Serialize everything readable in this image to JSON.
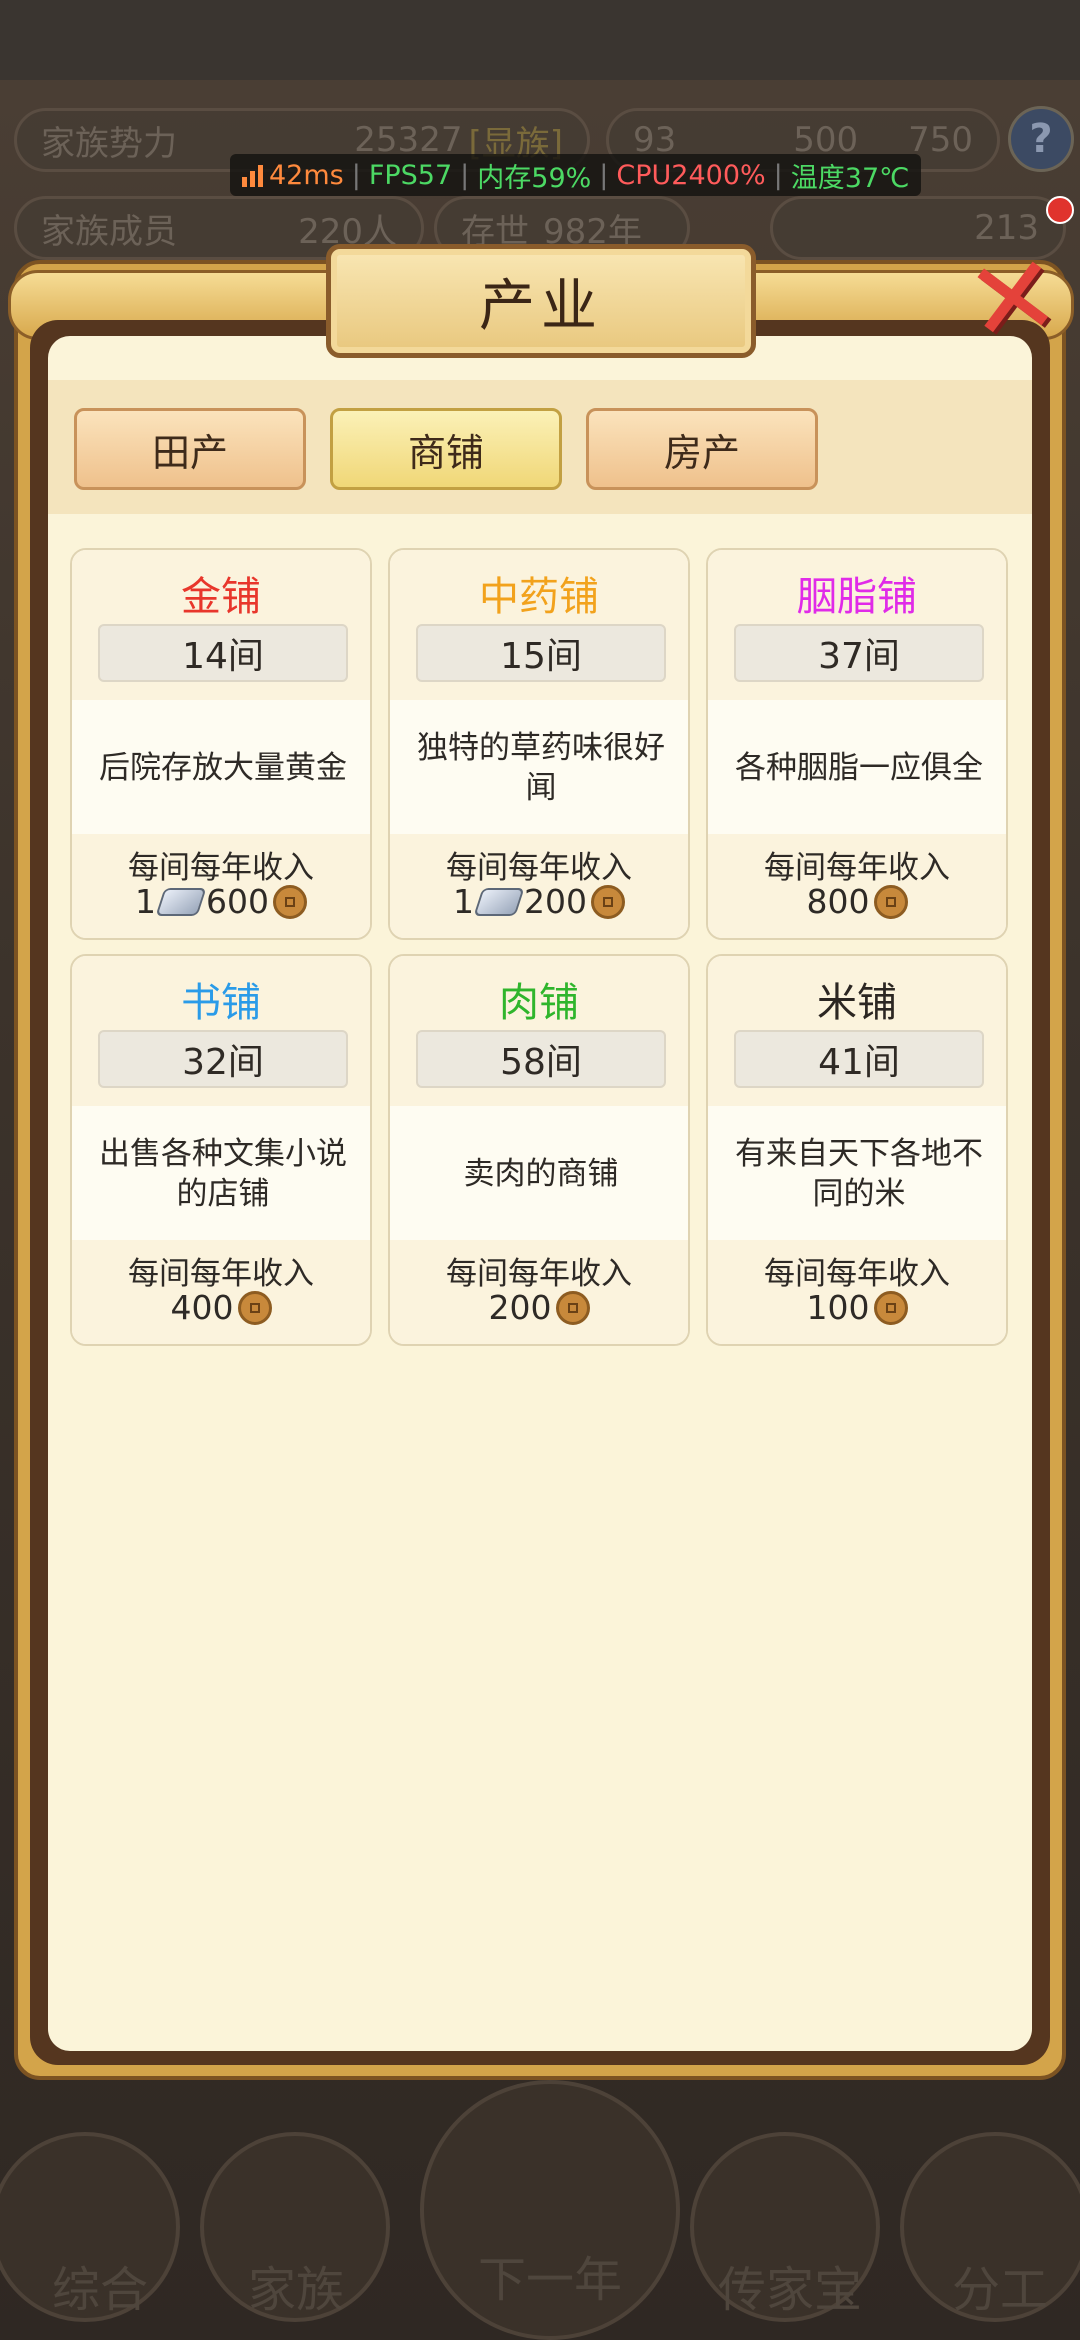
{
  "hud": {
    "power_label": "家族势力",
    "power_value": "25327",
    "power_rank": "[显族]",
    "members_label": "家族成员",
    "members_value": "220人",
    "lifespan_label": "存世",
    "lifespan_value": "982年",
    "res_gold": "93",
    "res_silver": "500",
    "res_coins": "750",
    "ingot_count": "213",
    "help": "?"
  },
  "perf": {
    "ping": "42ms",
    "fps": "FPS57",
    "memory": "内存59%",
    "cpu": "CPU2400%",
    "temp": "温度37℃"
  },
  "modal": {
    "title": "产业",
    "close_icon": "close-x-icon",
    "tabs": [
      {
        "label": "田产",
        "active": false
      },
      {
        "label": "商铺",
        "active": true
      },
      {
        "label": "房产",
        "active": false
      }
    ]
  },
  "shops": [
    {
      "name": "金铺",
      "color": "#e8362b",
      "count": "14间",
      "desc": "后院存放大量黄金",
      "income_label": "每间每年收入",
      "income_silver": "1",
      "income_coins": "600"
    },
    {
      "name": "中药铺",
      "color": "#f2a21c",
      "count": "15间",
      "desc": "独特的草药味很好闻",
      "income_label": "每间每年收入",
      "income_silver": "1",
      "income_coins": "200"
    },
    {
      "name": "胭脂铺",
      "color": "#e02be8",
      "count": "37间",
      "desc": "各种胭脂一应俱全",
      "income_label": "每间每年收入",
      "income_silver": "",
      "income_coins": "800"
    },
    {
      "name": "书铺",
      "color": "#2a9be8",
      "count": "32间",
      "desc": "出售各种文集小说的店铺",
      "income_label": "每间每年收入",
      "income_silver": "",
      "income_coins": "400"
    },
    {
      "name": "肉铺",
      "color": "#2fb52c",
      "count": "58间",
      "desc": "卖肉的商铺",
      "income_label": "每间每年收入",
      "income_silver": "",
      "income_coins": "200"
    },
    {
      "name": "米铺",
      "color": "#2b2622",
      "count": "41间",
      "desc": "有来自天下各地不同的米",
      "income_label": "每间每年收入",
      "income_silver": "",
      "income_coins": "100"
    }
  ],
  "bottom_nav": [
    "综合",
    "家族",
    "下一年",
    "传家宝",
    "分工"
  ]
}
